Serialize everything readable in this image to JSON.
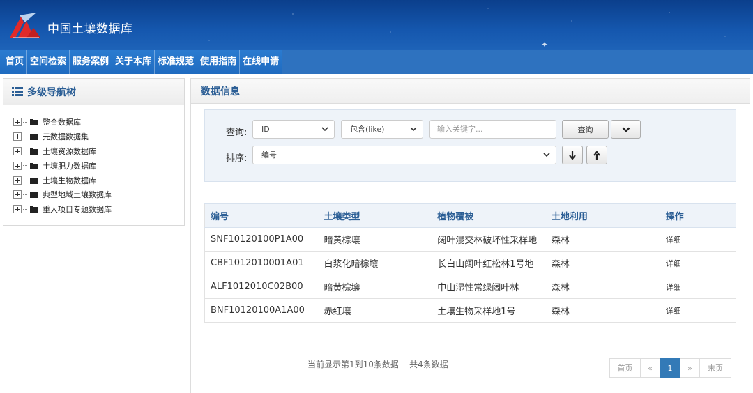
{
  "site": {
    "title": "中国土壤数据库"
  },
  "nav": [
    "首页",
    "空间检索",
    "服务案例",
    "关于本库",
    "标准规范",
    "使用指南",
    "在线申请"
  ],
  "left": {
    "title": "多级导航树",
    "tree": [
      "整合数据库",
      "元数据数据集",
      "土壤资源数据库",
      "土壤肥力数据库",
      "土壤生物数据库",
      "典型地域土壤数据库",
      "重大项目专题数据库"
    ]
  },
  "right": {
    "title": "数据信息",
    "query": {
      "label": "查询:",
      "field": "ID",
      "operator": "包含(like)",
      "keyword_placeholder": "输入关键字...",
      "search_label": "查询",
      "sort_label": "排序:",
      "sort_field": "编号"
    },
    "table": {
      "headers": [
        "编号",
        "土壤类型",
        "植物覆被",
        "土地利用",
        "操作"
      ],
      "rows": [
        [
          "SNF10120100P1A00",
          "暗黄棕壤",
          "阔叶混交林破坏性采样地",
          "森林",
          "详细"
        ],
        [
          "CBF1012010001A01",
          "白浆化暗棕壤",
          "长白山阔叶红松林1号地",
          "森林",
          "详细"
        ],
        [
          "ALF1012010C02B00",
          "暗黄棕壤",
          "中山湿性常绿阔叶林",
          "森林",
          "详细"
        ],
        [
          "BNF10120100A1A00",
          "赤红壤",
          "土壤生物采样地1号",
          "森林",
          "详细"
        ]
      ]
    },
    "footer_info": "当前显示第1到10条数据    共4条数据",
    "pager": {
      "first": "首页",
      "prev": "«",
      "current": "1",
      "next": "»",
      "last": "末页"
    }
  },
  "colors": {
    "header": "#1557ae",
    "nav": "#2a7bd0",
    "accent": "#337ab7",
    "title": "#2b5e95"
  }
}
